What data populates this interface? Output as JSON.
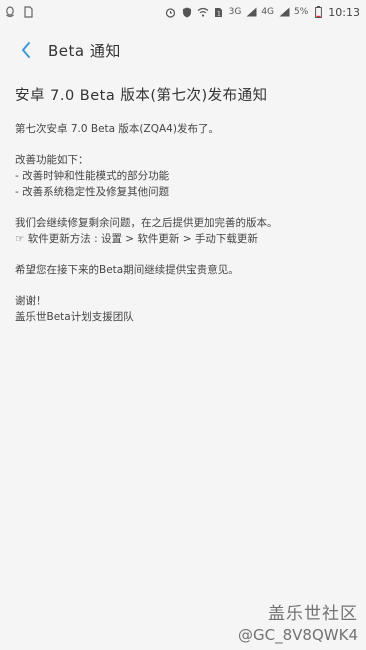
{
  "status_bar": {
    "left_icons": [
      "qq-icon",
      "sim-icon"
    ],
    "network_label_1": "3G",
    "network_label_2": "4G",
    "battery_pct": "5%",
    "time": "10:13"
  },
  "header": {
    "title": "Beta 通知"
  },
  "article": {
    "title": "安卓 7.0 Beta 版本(第七次)发布通知",
    "intro": "第七次安卓 7.0 Beta 版本(ZQA4)发布了。",
    "improvements_heading": "改善功能如下：",
    "improvements": [
      "- 改善时钟和性能模式的部分功能",
      "- 改善系统稳定性及修复其他问题"
    ],
    "continue_note": "我们会继续修复剩余问题，在之后提供更加完善的版本。",
    "update_method": "☞ 软件更新方法 : 设置 > 软件更新 > 手动下载更新",
    "feedback_request": "希望您在接下来的Beta期间继续提供宝贵意见。",
    "thanks": "谢谢！",
    "signature": "盖乐世Beta计划支援团队"
  },
  "watermark": {
    "brand": "盖乐世社区",
    "user": "@GC_8V8QWK4"
  }
}
